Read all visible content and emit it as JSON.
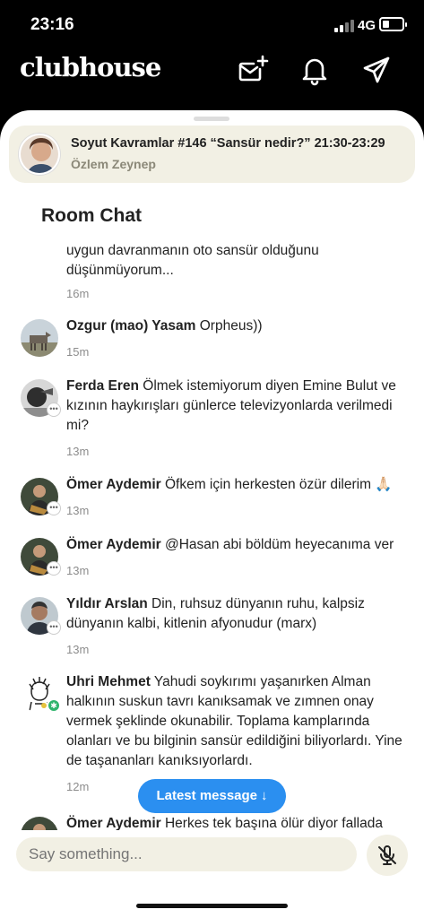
{
  "status_bar": {
    "time": "23:16",
    "network": "4G",
    "battery_level": 0.35
  },
  "app": {
    "logo": "clubhouse"
  },
  "header_icons": [
    "new-message-icon",
    "bell-icon",
    "send-icon"
  ],
  "room": {
    "title": "Soyut Kavramlar #146 “Sansür nedir?” 21:30-23:29",
    "host": "Özlem Zeynep"
  },
  "chat": {
    "heading": "Room Chat",
    "messages": [
      {
        "name": "",
        "text": "uygun davranmanın oto sansür olduğunu düşünmüyorum...",
        "time": "16m"
      },
      {
        "name": "Ozgur (mao) Yasam",
        "text": "Orpheus))",
        "time": "15m"
      },
      {
        "name": "Ferda Eren",
        "text": "Ölmek istemiyorum diyen Emine Bulut ve kızının haykırışları günlerce televizyonlarda verilmedi mi?",
        "time": "13m"
      },
      {
        "name": "Ömer Aydemir",
        "text": "Öfkem için herkesten özür dilerim 🙏🏻",
        "time": "13m"
      },
      {
        "name": "Ömer Aydemir",
        "text": "@Hasan abi böldüm heyecanıma ver",
        "time": "13m"
      },
      {
        "name": "Yıldır Arslan",
        "text": "Din, ruhsuz dünyanın ruhu, kalpsiz dünyanın kalbi, kitlenin afyonudur (marx)",
        "time": "13m"
      },
      {
        "name": "Uhri Mehmet",
        "text": "Yahudi soykırımı yaşanırken Alman halkının suskun tavrı kanıksamak ve zımnen onay vermek şeklinde okunabilir. Toplama kamplarında olanları ve bu bilginin sansür edildiğini biliyorlardı. Yine de taşananları kanıksıyorlardı.",
        "time": "12m"
      },
      {
        "name": "Ömer Aydemir",
        "text": "Herkes tek başına ölür diyor fallada",
        "time": ""
      }
    ]
  },
  "latest_button": {
    "label": "Latest message",
    "arrow": "↓"
  },
  "composer": {
    "placeholder": "Say something...",
    "mic_icon": "mic-muted-icon"
  },
  "colors": {
    "accent": "#2b8ff0",
    "cream": "#f2f0e4",
    "online": "#2fb46c"
  }
}
